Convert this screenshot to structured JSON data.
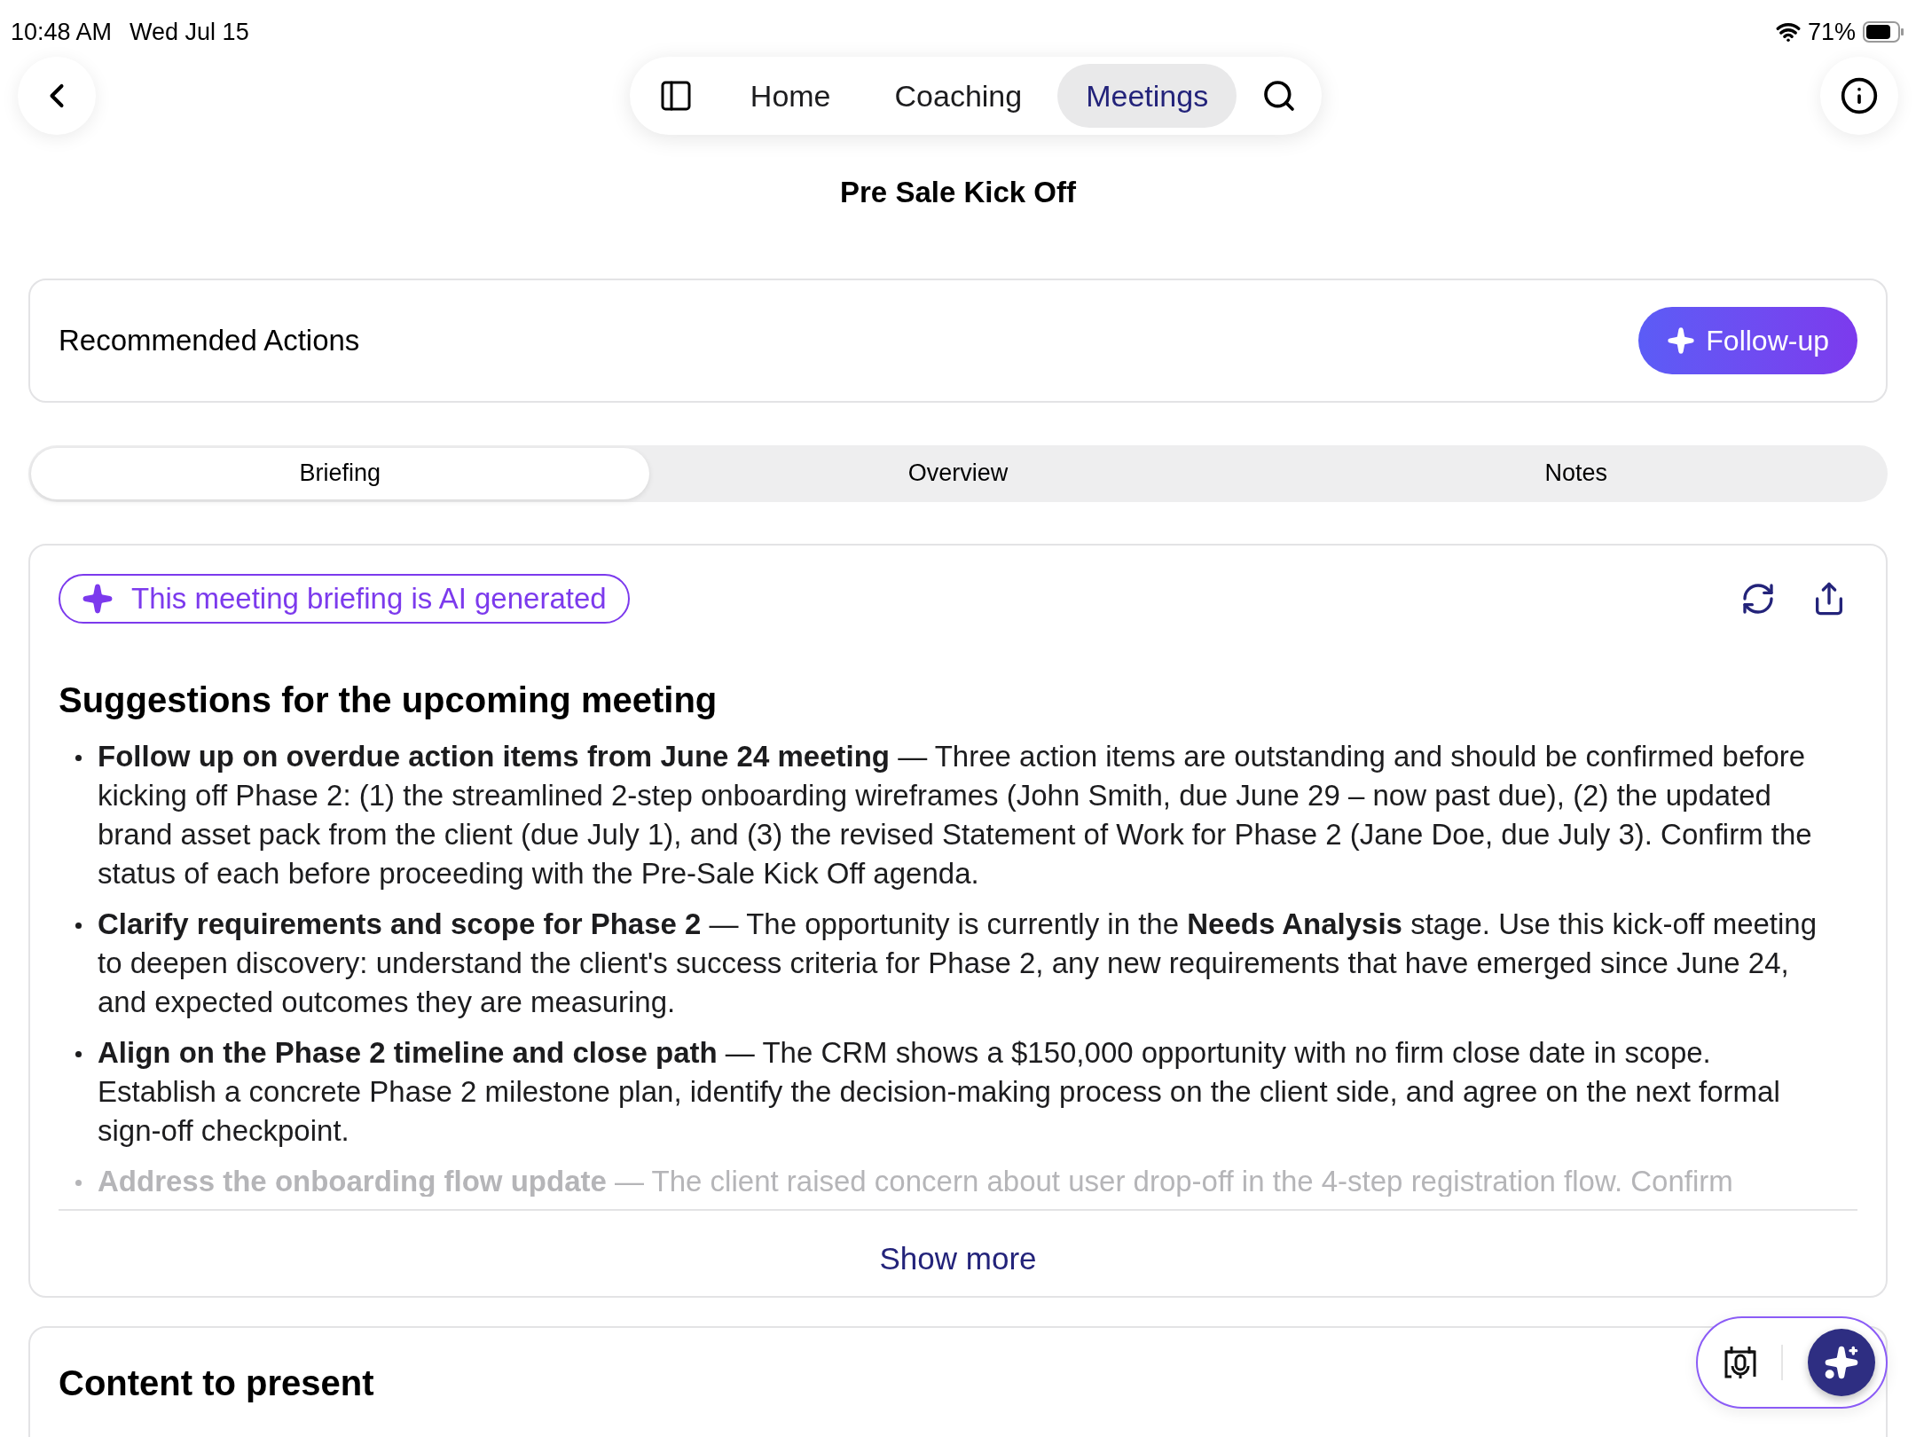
{
  "status_bar": {
    "time": "10:48 AM",
    "date": "Wed Jul 15",
    "battery": "71%"
  },
  "nav": {
    "tabs": [
      {
        "label": "Home",
        "selected": false
      },
      {
        "label": "Coaching",
        "selected": false
      },
      {
        "label": "Meetings",
        "selected": true
      }
    ]
  },
  "title": "Pre Sale Kick Off",
  "recommended": {
    "label": "Recommended Actions",
    "button": "Follow-up"
  },
  "segments": [
    {
      "label": "Briefing",
      "selected": true
    },
    {
      "label": "Overview",
      "selected": false
    },
    {
      "label": "Notes",
      "selected": false
    }
  ],
  "briefing": {
    "badge": "This meeting briefing is AI generated",
    "heading": "Suggestions for the upcoming meeting",
    "items": [
      {
        "text": "**Follow up on overdue action items from June 24 meeting** — Three action items are outstanding and should be confirmed before kicking off Phase 2: (1) the streamlined 2-step onboarding wireframes (John Smith, due June 29 – now past due), (2) the updated brand asset pack from the client (due July 1), and (3) the revised Statement of Work for Phase 2 (Jane Doe, due July 3). Confirm the status of each before proceeding with the Pre-Sale Kick Off agenda.",
        "faded": false
      },
      {
        "text": "**Clarify requirements and scope for Phase 2** — The opportunity is currently in the **Needs Analysis** stage. Use this kick-off meeting to deepen discovery: understand the client's success criteria for Phase 2, any new requirements that have emerged since June 24, and expected outcomes they are measuring.",
        "faded": false
      },
      {
        "text": "**Align on the Phase 2 timeline and close path** — The CRM shows a $150,000 opportunity with no firm close date in scope. Establish a concrete Phase 2 milestone plan, identify the decision-making process on the client side, and agree on the next formal sign-off checkpoint.",
        "faded": false
      },
      {
        "text": "**Address the onboarding flow update** — The client raised concern about user drop-off in the 4-step registration flow. Confirm",
        "faded": true
      }
    ],
    "show_more": "Show more"
  },
  "content_card": {
    "heading": "Content to present"
  }
}
